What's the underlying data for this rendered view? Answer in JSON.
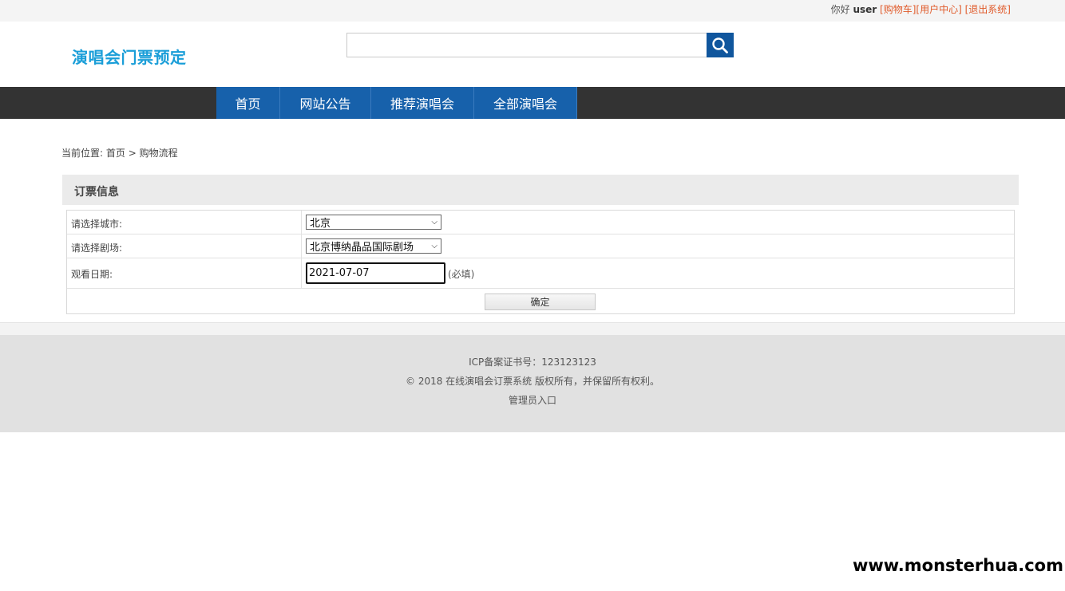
{
  "topbar": {
    "greeting": "你好",
    "username": "user",
    "cart_link": "[购物车]",
    "user_center_link": "[用户中心]",
    "logout_link": "[退出系统]"
  },
  "header": {
    "logo": "演唱会门票预定",
    "search": {
      "value": "",
      "placeholder": ""
    },
    "search_icon": "search-icon"
  },
  "nav": {
    "items": [
      "首页",
      "网站公告",
      "推荐演唱会",
      "全部演唱会"
    ]
  },
  "breadcrumb": {
    "prefix": "当前位置:",
    "home": "首页",
    "separator": ">",
    "current": "购物流程"
  },
  "panel": {
    "title": "订票信息",
    "city_label": "请选择城市:",
    "city_value": "北京",
    "venue_label": "请选择剧场:",
    "venue_value": "北京博纳晶品国际剧场",
    "date_label": "观看日期:",
    "date_value": "2021-07-07",
    "required_note": "(必填)",
    "submit_label": "确定"
  },
  "footer": {
    "icp": "ICP备案证书号：123123123",
    "copyright": "© 2018 在线演唱会订票系统 版权所有，并保留所有权利。",
    "admin_link": "管理员入口"
  },
  "watermark": "www.monsterhua.com",
  "colors": {
    "brand": "#1a9ed8",
    "nav_active": "#1761ab",
    "nav_bar": "#333333",
    "link": "#e05a2a"
  }
}
